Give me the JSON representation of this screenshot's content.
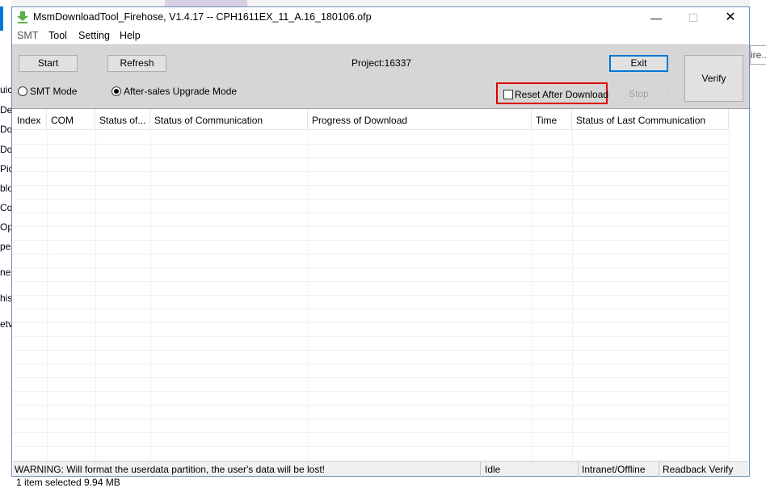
{
  "window": {
    "title": "MsmDownloadTool_Firehose, V1.4.17 -- CPH1611EX_11_A.16_180106.ofp",
    "minimize_glyph": "—",
    "maximize_glyph": "☐",
    "close_glyph": "✕"
  },
  "menu": {
    "items": [
      "SMT",
      "Tool",
      "Setting",
      "Help"
    ]
  },
  "toolbar": {
    "start_label": "Start",
    "refresh_label": "Refresh",
    "project_text": "Project:16337",
    "exit_label": "Exit",
    "verify_label": "Verify",
    "stop_label": "Stop",
    "smt_mode_label": "SMT Mode",
    "smt_mode_checked": false,
    "aftersales_label": "After-sales Upgrade Mode",
    "aftersales_checked": true,
    "reset_label": "Reset After Download",
    "reset_checked": false,
    "highlight_color": "#e00000"
  },
  "table": {
    "columns": [
      "Index",
      "COM",
      "Status of...",
      "Status of Communication",
      "Progress of Download",
      "Time",
      "Status of Last Communication"
    ],
    "rows": []
  },
  "statusbar": {
    "warning": "WARNING: Will format the userdata partition, the user's data will be lost!",
    "state": "Idle",
    "network": "Intranet/Offline",
    "readback": "Readback Verify"
  },
  "background": {
    "left_fragments": [
      "uic",
      "De",
      "Do",
      "Do",
      "Pic",
      "blo",
      "Co",
      "Op",
      "pe",
      "ne",
      "his",
      "etv"
    ],
    "right_fragment": "ire...",
    "explorer_status": "1 item selected  9.94 MB"
  }
}
